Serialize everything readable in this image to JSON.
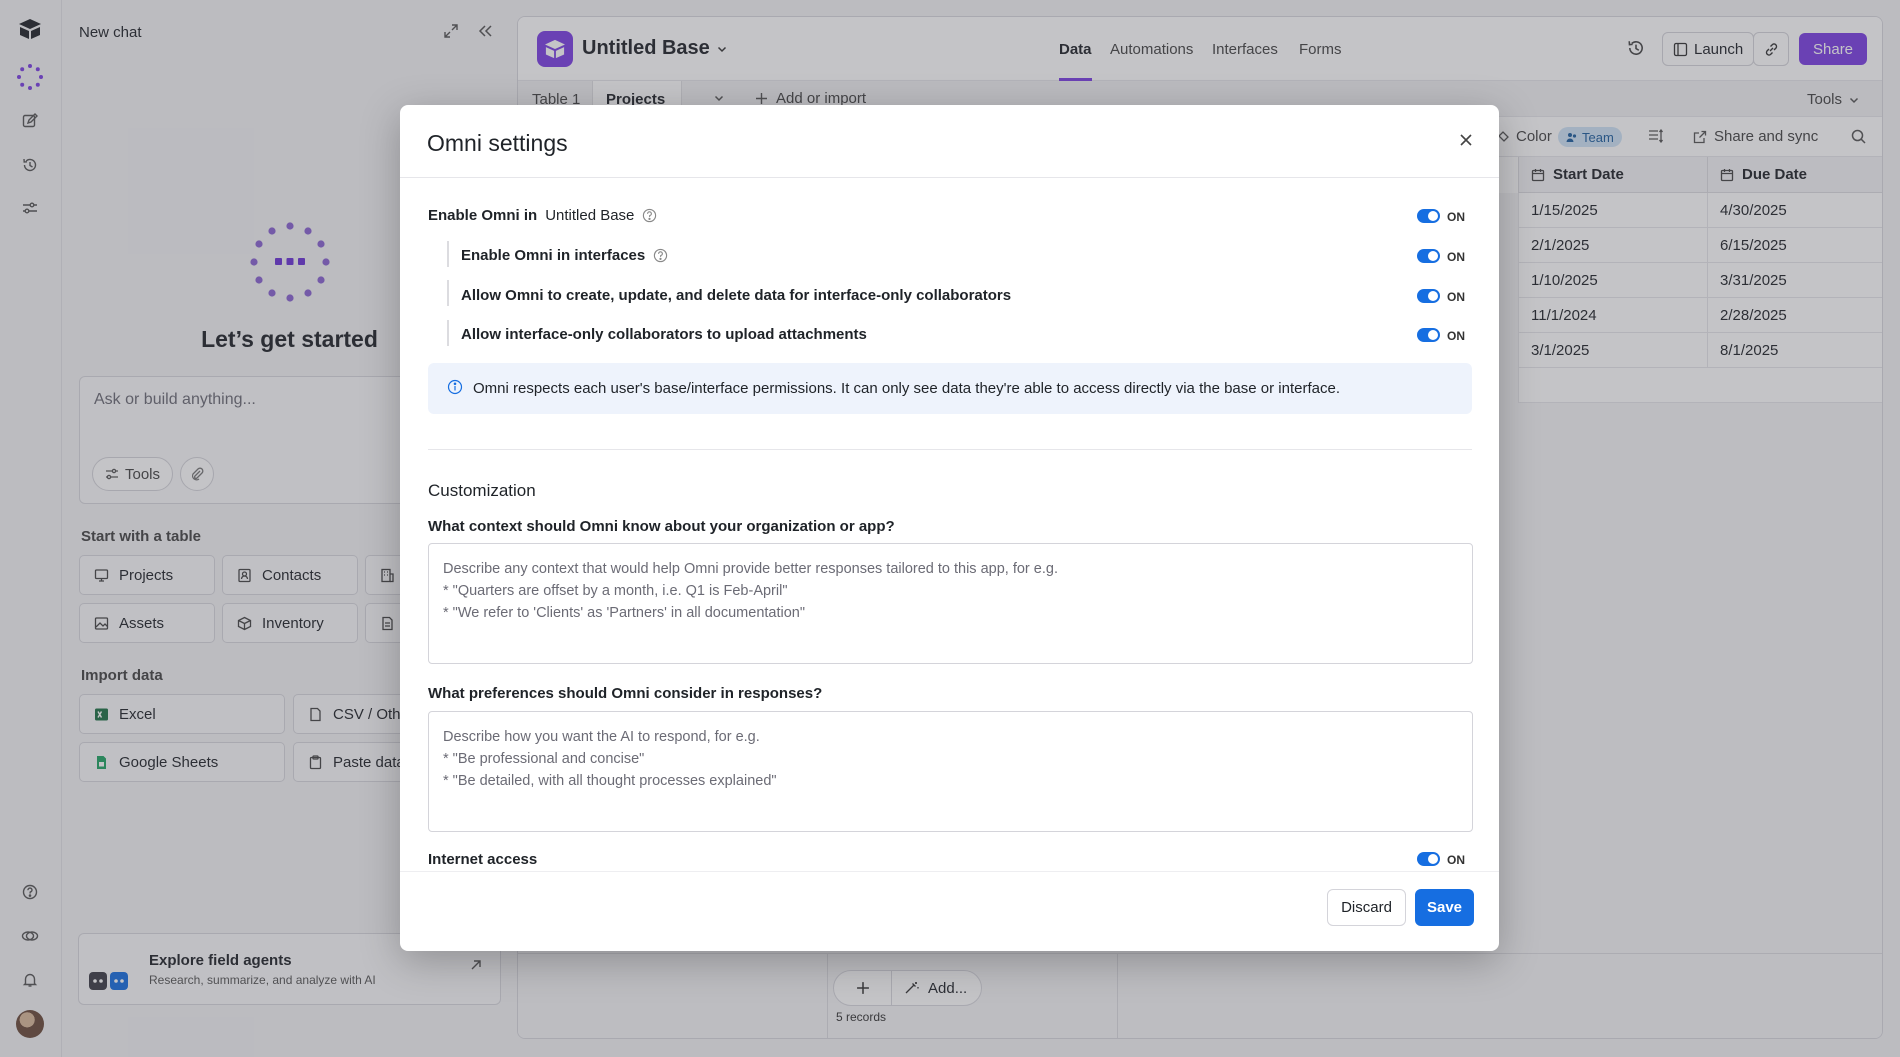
{
  "rail": {
    "icons": [
      "app-logo-icon",
      "omni-icon",
      "compose-icon",
      "history-icon",
      "sliders-icon",
      "help-icon",
      "community-icon",
      "bell-icon"
    ]
  },
  "chat": {
    "title": "New chat",
    "heading": "Let’s get started",
    "ask_placeholder": "Ask or build anything...",
    "tools_label": "Tools",
    "start_table_label": "Start with a table",
    "tables": [
      "Projects",
      "Contacts",
      "Assets",
      "Inventory"
    ],
    "import_label": "Import data",
    "imports": [
      "Excel",
      "CSV / Oth",
      "Google Sheets",
      "Paste data"
    ],
    "agents_title": "Explore field agents",
    "agents_subtitle": "Research, summarize, and analyze with AI"
  },
  "base": {
    "name": "Untitled Base",
    "nav": [
      "Data",
      "Automations",
      "Interfaces",
      "Forms"
    ],
    "launch_label": "Launch",
    "share_label": "Share",
    "tables": [
      "Table 1",
      "Projects"
    ],
    "add_import_label": "Add or import",
    "tools_label": "Tools",
    "color_label": "Color",
    "team_label": "Team",
    "share_sync_label": "Share and sync",
    "columns": [
      "Start Date",
      "Due Date"
    ],
    "rows": [
      [
        "1/15/2025",
        "4/30/2025"
      ],
      [
        "2/1/2025",
        "6/15/2025"
      ],
      [
        "1/10/2025",
        "3/31/2025"
      ],
      [
        "11/1/2024",
        "2/28/2025"
      ],
      [
        "3/1/2025",
        "8/1/2025"
      ]
    ],
    "add_label": "Add...",
    "records_label": "5 records"
  },
  "modal": {
    "title": "Omni settings",
    "enable_prefix": "Enable Omni in",
    "enable_base": "Untitled Base",
    "enable_interfaces": "Enable Omni in interfaces",
    "allow_crud": "Allow Omni to create, update, and delete data for interface-only collaborators",
    "allow_upload": "Allow interface-only collaborators to upload attachments",
    "on_label": "ON",
    "info_text": "Omni respects each user's base/interface permissions. It can only see data they're able to access directly via the base or interface.",
    "customization_heading": "Customization",
    "context_question": "What context should Omni know about your organization or app?",
    "context_placeholder": [
      "Describe any context that would help Omni provide better responses tailored to this app, for e.g.",
      "* \"Quarters are offset by a month, i.e. Q1 is Feb-April\"",
      "* \"We refer to 'Clients' as 'Partners' in all documentation\""
    ],
    "prefs_question": "What preferences should Omni consider in responses?",
    "prefs_placeholder": [
      "Describe how you want the AI to respond, for e.g.",
      "* \"Be professional and concise\"",
      "* \"Be detailed, with all thought processes explained\""
    ],
    "internet_label": "Internet access",
    "discard_label": "Discard",
    "save_label": "Save"
  }
}
